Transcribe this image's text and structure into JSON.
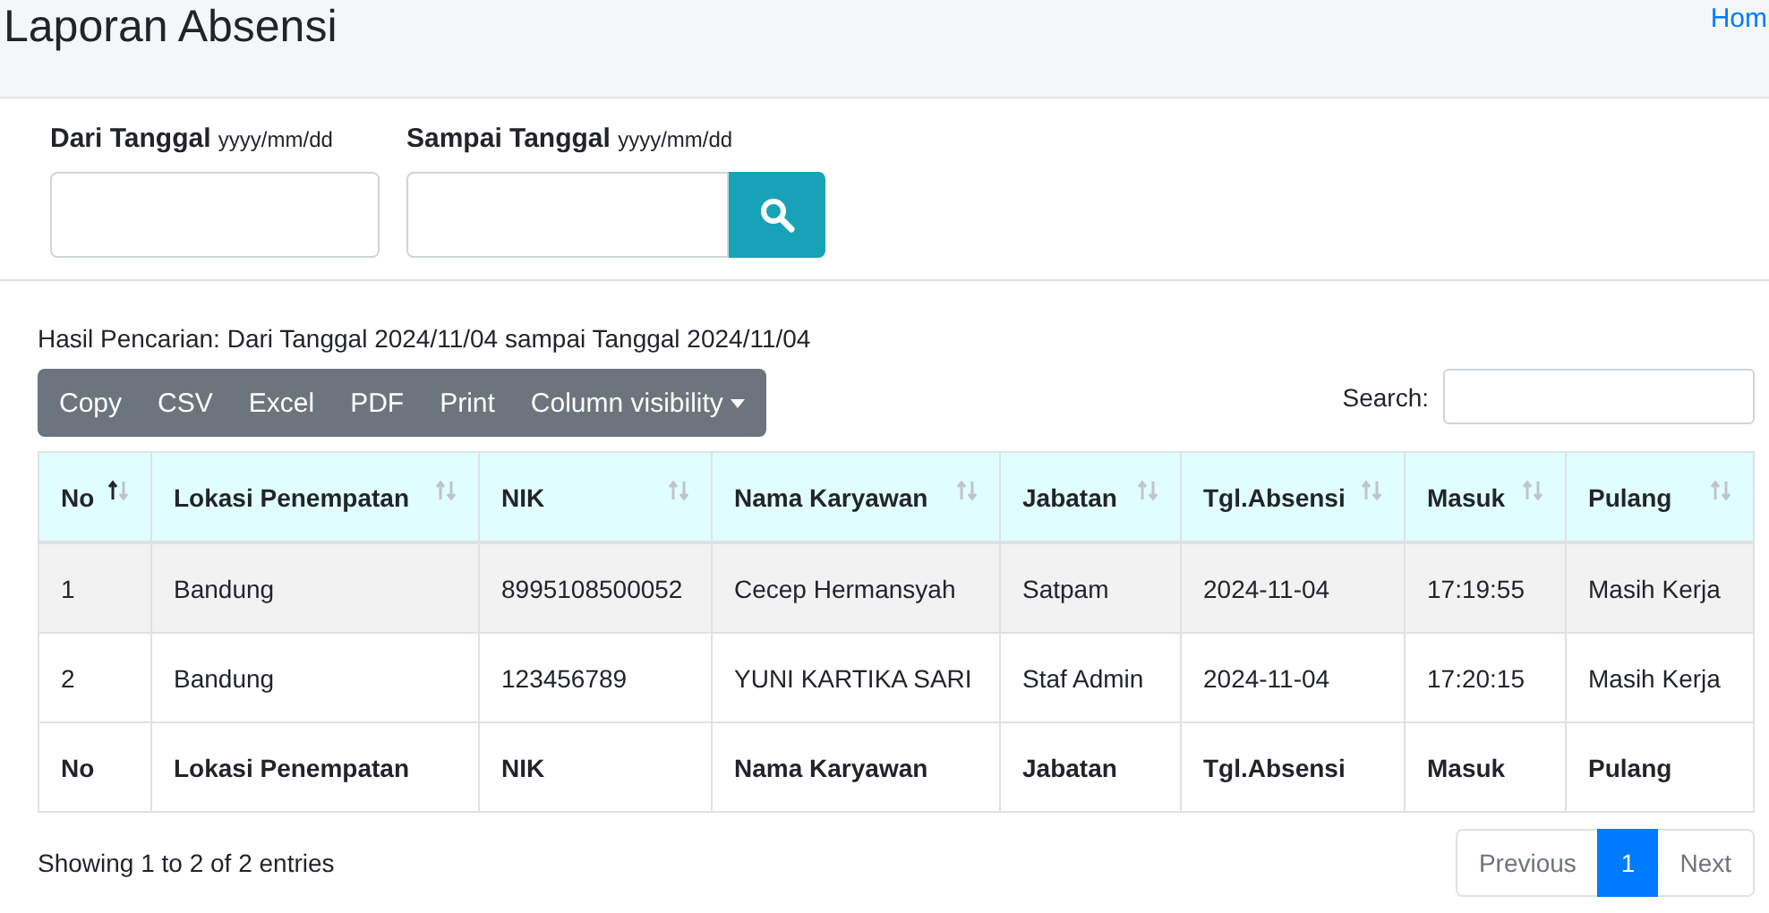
{
  "page": {
    "title": "Laporan Absensi",
    "breadcrumb": "Hom"
  },
  "filter": {
    "fields": [
      {
        "label": "Dari Tanggal",
        "hint": "yyyy/mm/dd"
      },
      {
        "label": "Sampai Tanggal",
        "hint": "yyyy/mm/dd"
      }
    ]
  },
  "result_text": "Hasil Pencarian: Dari Tanggal 2024/11/04 sampai Tanggal 2024/11/04",
  "export_buttons": [
    {
      "label": "Copy",
      "kind": "plain"
    },
    {
      "label": "CSV",
      "kind": "plain"
    },
    {
      "label": "Excel",
      "kind": "plain"
    },
    {
      "label": "PDF",
      "kind": "plain"
    },
    {
      "label": "Print",
      "kind": "plain"
    },
    {
      "label": "Column visibility",
      "kind": "dropdown"
    }
  ],
  "search": {
    "label": "Search:"
  },
  "table": {
    "columns": [
      {
        "label": "No",
        "sorted": true
      },
      {
        "label": "Lokasi Penempatan",
        "sorted": false
      },
      {
        "label": "NIK",
        "sorted": false
      },
      {
        "label": "Nama Karyawan",
        "sorted": false
      },
      {
        "label": "Jabatan",
        "sorted": false
      },
      {
        "label": "Tgl.Absensi",
        "sorted": false
      },
      {
        "label": "Masuk",
        "sorted": false
      },
      {
        "label": "Pulang",
        "sorted": false
      }
    ],
    "rows": [
      [
        "1",
        "Bandung",
        "8995108500052",
        "Cecep Hermansyah",
        "Satpam",
        "2024-11-04",
        "17:19:55",
        "Masih Kerja"
      ],
      [
        "2",
        "Bandung",
        "123456789",
        "YUNI KARTIKA SARI",
        "Staf Admin",
        "2024-11-04",
        "17:20:15",
        "Masih Kerja"
      ]
    ],
    "footer": [
      "No",
      "Lokasi Penempatan",
      "NIK",
      "Nama Karyawan",
      "Jabatan",
      "Tgl.Absensi",
      "Masuk",
      "Pulang"
    ]
  },
  "info": "Showing 1 to 2 of 2 entries",
  "pagination": [
    {
      "label": "Previous",
      "disabled": true,
      "selected": false
    },
    {
      "label": "1",
      "disabled": false,
      "selected": true
    },
    {
      "label": "Next",
      "disabled": true,
      "selected": false
    }
  ]
}
